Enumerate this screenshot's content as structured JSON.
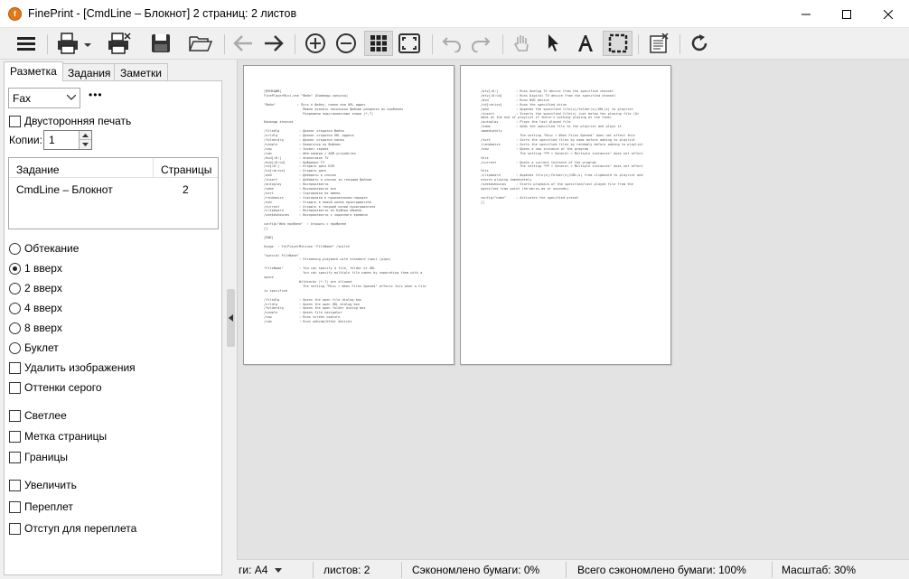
{
  "window": {
    "app_icon": "finepr-icon",
    "title": "FinePrint - [CmdLine – Блокнот] 2 страниц: 2 листов"
  },
  "toolbar": {
    "buttons": [
      {
        "name": "menu-icon"
      },
      {
        "name": "printer-dropdown-icon"
      },
      {
        "name": "print-delete-icon"
      },
      {
        "name": "save-icon"
      },
      {
        "name": "open-folder-icon"
      },
      {
        "name": "back-arrow-icon"
      },
      {
        "name": "forward-arrow-icon"
      },
      {
        "name": "zoom-in-icon"
      },
      {
        "name": "zoom-out-icon"
      },
      {
        "name": "grid-view-icon"
      },
      {
        "name": "fit-page-icon"
      },
      {
        "name": "undo-icon"
      },
      {
        "name": "redo-icon"
      },
      {
        "name": "hand-tool-icon"
      },
      {
        "name": "pointer-tool-icon"
      },
      {
        "name": "text-tool-icon"
      },
      {
        "name": "select-area-icon"
      },
      {
        "name": "notes-icon"
      },
      {
        "name": "refresh-icon"
      }
    ]
  },
  "sidebar": {
    "tabs": [
      "Разметка",
      "Задания",
      "Заметки"
    ],
    "printer_select": "Fax",
    "more_label": "•••",
    "duplex_label": "Двусторонняя печать",
    "copies_label": "Копии:",
    "copies_value": "1",
    "job_table": {
      "headers": [
        "Задание",
        "Страницы"
      ],
      "rows": [
        {
          "name": "CmdLine – Блокнот",
          "pages": "2"
        }
      ]
    },
    "layout_options": [
      {
        "label": "Обтекание",
        "checked": false
      },
      {
        "label": "1 вверх",
        "checked": true
      },
      {
        "label": "2 вверх",
        "checked": false
      },
      {
        "label": "4 вверх",
        "checked": false
      },
      {
        "label": "8 вверх",
        "checked": false
      },
      {
        "label": "Буклет",
        "checked": false
      }
    ],
    "checkboxes_a": [
      "Удалить изображения",
      "Оттенки серого"
    ],
    "checkboxes_b": [
      "Светлее",
      "Метка страницы",
      "Границы"
    ],
    "checkboxes_c": [
      "Увеличить",
      "Переплет",
      "Отступ для переплета"
    ]
  },
  "preview": {
    "page1_lines": [
      "[ФУНКЦИИ]",
      "FinePlayerMini.exe \"Файл\" [Команды запуска]",
      "",
      "\"Файл\"           : Путь к файлу, папке или URL адрес",
      "                    Можно указать несколько файлов разделяя их пробелом",
      "                    Разрешены подстановочные знаки (*,?)",
      "",
      "Команды запуска",
      "",
      "/filedlg          : Диалог открытия файла",
      "/urldlg           : Диалог открытия URL адреса",
      "/folderdlg        : Диалог открытия папки",
      "/simple           : Навигатор по файлам",
      "/cap              : Захват экрана",
      "/cam              : Web-камера / ADM-устройство",
      "/dvd[=D:]         : Аналоговое TV",
      "/dvb[=D:%d]       : Цифровое TV",
      "/cd[=D:]          : Открыть диск DVD",
      "/cd[=drive]       : Открыть диск",
      "/add              : Добавить в список",
      "/insert           : Добавить в список за текущим файлом",
      "/autoplay         : Воспроизвести",
      "/same             : Воспроизвести все",
      "/sort             : Сортировка по имени",
      "/randomize        : Сортировка в произвольном порядке",
      "/new              : Открыть в новой копии проигрывателя",
      "/current          : Открыть в текущей копии проигрывателя",
      "/clipboard        : Воспроизвести из буфера обмена",
      "/seekdshow=ms     : Воспроизвести с заданного времени",
      "",
      "config=\"Имя профиля\"  : Открыть с профилем",
      "[]",
      "",
      "[ЕЩЕ]",
      "",
      "Usage  : FolPlayerMiniuse \"FileName\" /switch",
      "",
      "\"special FileName\"",
      "                  : Streaming playback with standard input (pipe)",
      "",
      "\"FileName\"        : You can specify a file, folder or URL",
      "                    You can specify multiple file names by separating them with a",
      "space",
      "                  Wildcards (*,?) are allowed",
      "                    The setting \"Misc > When Files Opened\" affects this when a file",
      "is specified",
      "",
      "/filedlg          : Opens the open file dialog box",
      "/urldlg           : Opens the open URL dialog box",
      "/folderdlg        : Opens the open folder dialog box",
      "/simple           : Opens file navigator",
      "/cap              : Runs screen capture",
      "/cam              : Runs webcam/Other devices"
    ],
    "page2_lines": [
      "/atv[=D:]         : Runs Analog TV device from the specified channel",
      "/dtv[=D:%d]       : Runs Digital TV device from the specified channel",
      "/dvd              : Runs DVD device",
      "/cd[=drive]       : Runs the specified drive",
      "/add              : Appends the specified file(s)/folder(s)/URL(s) to playlist",
      "/insert           : Inserts the specified file(s) just below the playing file (Or",
      "adds at the end of playlist if there's nothing playing at the time)",
      "/autoplay         : Plays the last played file",
      "/same             : Adds the specified file to the playlist and plays it",
      "immediately",
      "                    The setting \"Misc > When Files Opened\" does not affect this",
      "/sort             : Sorts the specified files by name before adding to playlist",
      "/randomize        : Sorts the specified files by randomly before adding to playlist",
      "/new              : Opens a new instance of the program",
      "                    The setting \"PP > General > Multiple instances\" does not affect",
      "this",
      "/current          : Opens a current instance of the program",
      "                    The setting \"PP > General > Multiple instances\" does not affect",
      "this",
      "/clipboard        : Appends file(s)/folder(s)/URL(s) from clipboard to playlist and",
      "starts playing immediately",
      "/seekdshow=ms     : Starts playback of the specified/last played file from the",
      "specified time point (hh:mm:ss.ms or seconds)",
      "",
      "config=\"name\"     : Activates the specified preset",
      "[]"
    ]
  },
  "statusbar": {
    "paper": "ги: A4",
    "sheets": "листов: 2",
    "saved": "Сэкономлено бумаги: 0%",
    "total_saved": "Всего сэкономлено бумаги: 100%",
    "zoom": "Масштаб: 30%"
  }
}
